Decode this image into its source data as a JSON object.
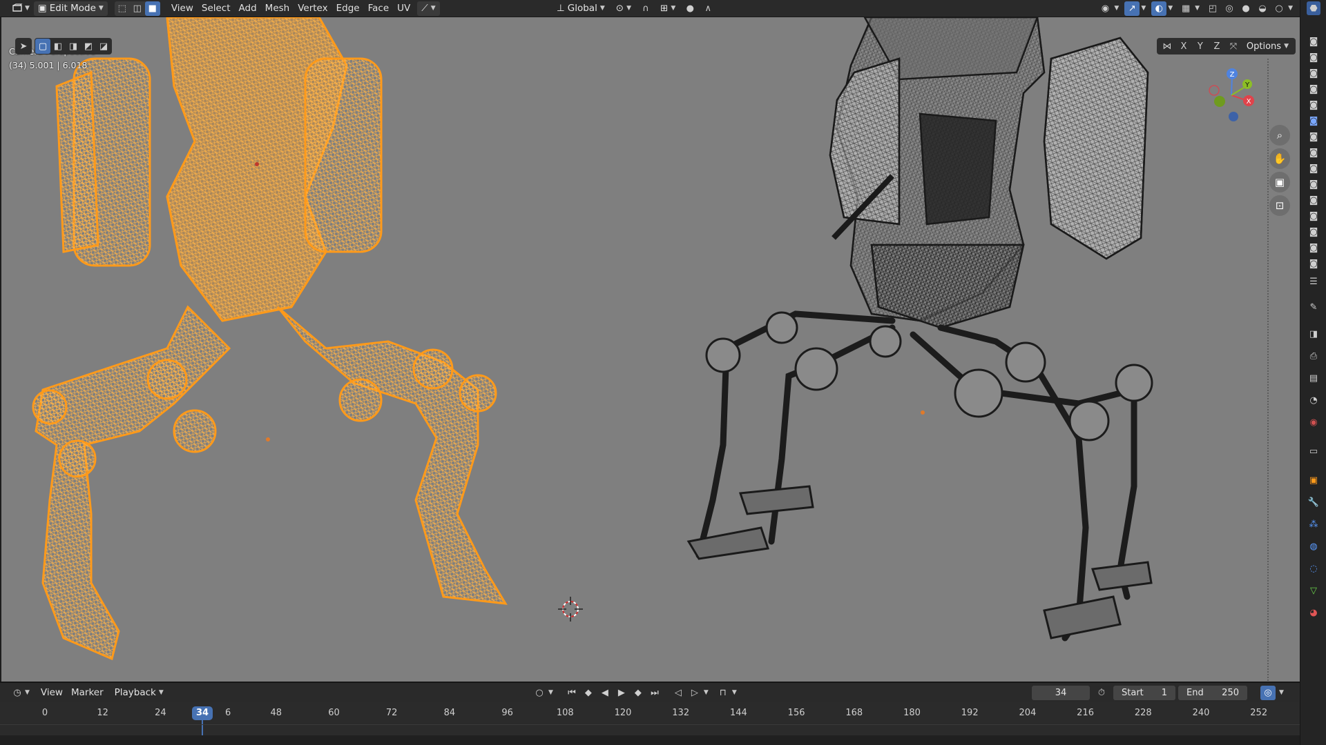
{
  "header": {
    "editor_icon": "viewport-editor-icon",
    "mode": "Edit Mode",
    "menus": [
      "View",
      "Select",
      "Add",
      "Mesh",
      "Vertex",
      "Edge",
      "Face",
      "UV"
    ],
    "orientation": "Global"
  },
  "viewport": {
    "overlay_title": "Camera Perspective",
    "overlay_info": "(34) 5.001 | 6.018",
    "axes": [
      "X",
      "Y",
      "Z"
    ],
    "options_label": "Options",
    "gizmo": {
      "z": "Z",
      "y": "Y",
      "x": "X"
    },
    "colors": {
      "background": "#7f7f7f",
      "selected_wire": "#ff9a1a",
      "unselected_wire": "#1e1e1e"
    }
  },
  "timeline": {
    "menus": [
      "View",
      "Marker",
      "Playback"
    ],
    "current_frame": "34",
    "start_label": "Start",
    "start_value": "1",
    "end_label": "End",
    "end_value": "250",
    "ticks": [
      "0",
      "12",
      "24",
      "36",
      "48",
      "60",
      "72",
      "84",
      "96",
      "108",
      "120",
      "132",
      "144",
      "156",
      "168",
      "180",
      "192",
      "204",
      "216",
      "228",
      "240",
      "252"
    ],
    "playhead_label": "34",
    "accent": "#4772b3"
  }
}
